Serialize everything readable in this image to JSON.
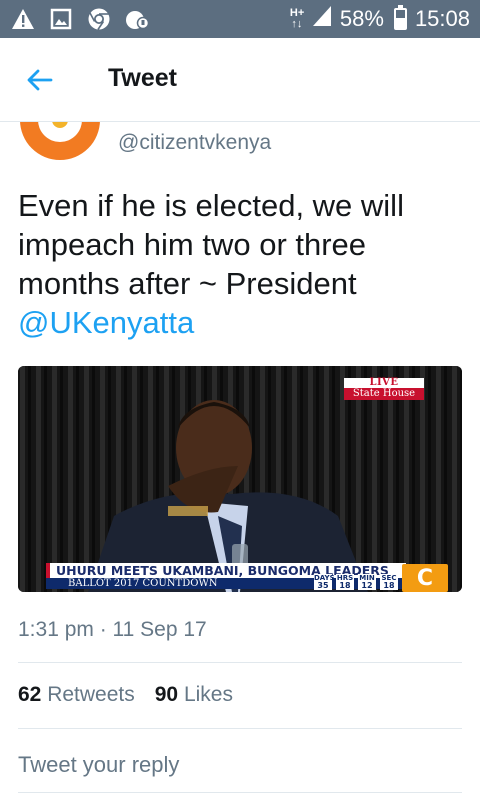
{
  "status_bar": {
    "network_type_top": "H+",
    "network_type_bottom": "↑↓",
    "battery_percent": "58%",
    "battery_level": 0.58,
    "time": "15:08",
    "left_icons": [
      "warning-icon",
      "image-icon",
      "chrome-icon",
      "clash-of-clans-icon"
    ]
  },
  "appbar": {
    "title": "Tweet"
  },
  "tweet": {
    "handle": "@citizentvkenya",
    "text_before_mention": "Even if he is elected, we will impeach him two or three months after ~ President ",
    "mention": "@UKenyatta",
    "timestamp": "1:31 pm · 11 Sep 17",
    "retweets_count": "62",
    "retweets_label": "Retweets",
    "likes_count": "90",
    "likes_label": "Likes"
  },
  "media": {
    "live_label": "LIVE",
    "live_location": "State House",
    "headline": "UHURU MEETS UKAMBANI, BUNGOMA LEADERS",
    "ticker": "BALLOT 2017 COUNTDOWN",
    "countdown": [
      {
        "label": "DAYS",
        "value": "35"
      },
      {
        "label": "HRS",
        "value": "18"
      },
      {
        "label": "MIN",
        "value": "12"
      },
      {
        "label": "SEC",
        "value": "18"
      }
    ],
    "channel_logo_letter": "C"
  },
  "reply": {
    "placeholder": "Tweet your reply"
  },
  "colors": {
    "status_bar": "#5c6e80",
    "accent": "#1da1f2",
    "muted_text": "#657786"
  }
}
